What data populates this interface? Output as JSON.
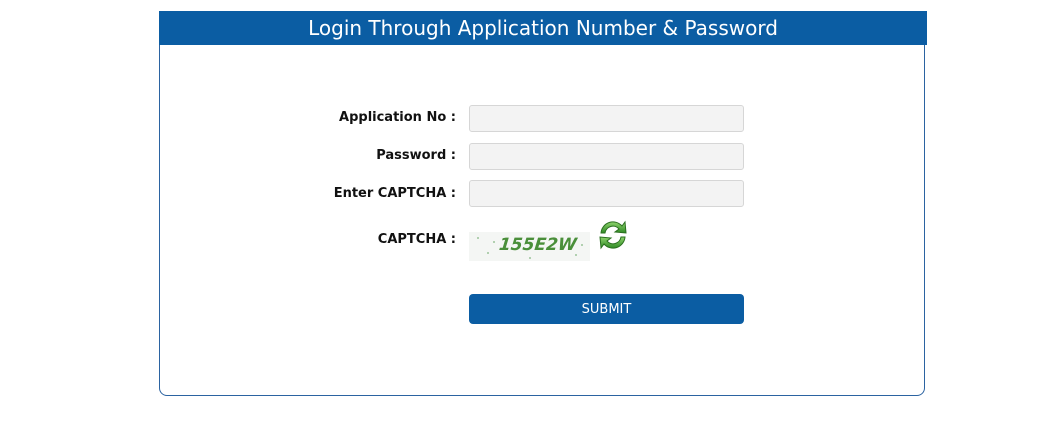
{
  "form": {
    "title": "Login Through Application Number & Password",
    "application_no_label": "Application No :",
    "application_no_value": "",
    "password_label": "Password :",
    "password_value": "",
    "enter_captcha_label": "Enter CAPTCHA :",
    "enter_captcha_value": "",
    "captcha_label": "CAPTCHA :",
    "captcha_text": "155E2W",
    "refresh_icon": "refresh-arrows-icon",
    "submit_label": "SUBMIT"
  },
  "colors": {
    "header_bg": "#0b5da3",
    "panel_border": "#2b63a1",
    "captcha_text": "#4a8f3a",
    "refresh_icon": "#4ca23a"
  }
}
